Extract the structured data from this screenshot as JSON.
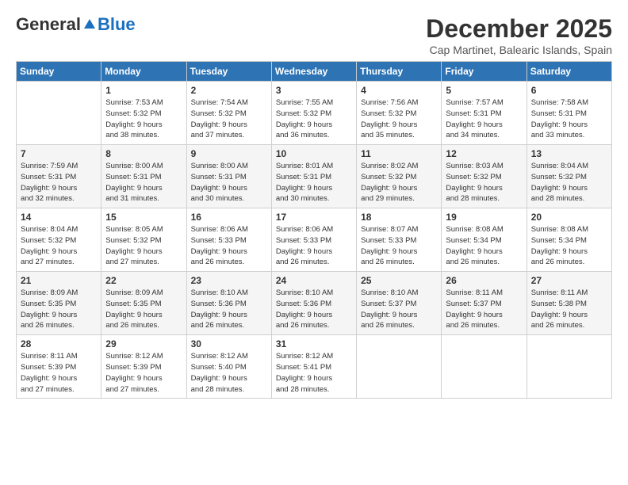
{
  "logo": {
    "general": "General",
    "blue": "Blue"
  },
  "title": "December 2025",
  "subtitle": "Cap Martinet, Balearic Islands, Spain",
  "days_of_week": [
    "Sunday",
    "Monday",
    "Tuesday",
    "Wednesday",
    "Thursday",
    "Friday",
    "Saturday"
  ],
  "weeks": [
    [
      {
        "day": "",
        "info": ""
      },
      {
        "day": "1",
        "info": "Sunrise: 7:53 AM\nSunset: 5:32 PM\nDaylight: 9 hours\nand 38 minutes."
      },
      {
        "day": "2",
        "info": "Sunrise: 7:54 AM\nSunset: 5:32 PM\nDaylight: 9 hours\nand 37 minutes."
      },
      {
        "day": "3",
        "info": "Sunrise: 7:55 AM\nSunset: 5:32 PM\nDaylight: 9 hours\nand 36 minutes."
      },
      {
        "day": "4",
        "info": "Sunrise: 7:56 AM\nSunset: 5:32 PM\nDaylight: 9 hours\nand 35 minutes."
      },
      {
        "day": "5",
        "info": "Sunrise: 7:57 AM\nSunset: 5:31 PM\nDaylight: 9 hours\nand 34 minutes."
      },
      {
        "day": "6",
        "info": "Sunrise: 7:58 AM\nSunset: 5:31 PM\nDaylight: 9 hours\nand 33 minutes."
      }
    ],
    [
      {
        "day": "7",
        "info": "Sunrise: 7:59 AM\nSunset: 5:31 PM\nDaylight: 9 hours\nand 32 minutes."
      },
      {
        "day": "8",
        "info": "Sunrise: 8:00 AM\nSunset: 5:31 PM\nDaylight: 9 hours\nand 31 minutes."
      },
      {
        "day": "9",
        "info": "Sunrise: 8:00 AM\nSunset: 5:31 PM\nDaylight: 9 hours\nand 30 minutes."
      },
      {
        "day": "10",
        "info": "Sunrise: 8:01 AM\nSunset: 5:31 PM\nDaylight: 9 hours\nand 30 minutes."
      },
      {
        "day": "11",
        "info": "Sunrise: 8:02 AM\nSunset: 5:32 PM\nDaylight: 9 hours\nand 29 minutes."
      },
      {
        "day": "12",
        "info": "Sunrise: 8:03 AM\nSunset: 5:32 PM\nDaylight: 9 hours\nand 28 minutes."
      },
      {
        "day": "13",
        "info": "Sunrise: 8:04 AM\nSunset: 5:32 PM\nDaylight: 9 hours\nand 28 minutes."
      }
    ],
    [
      {
        "day": "14",
        "info": "Sunrise: 8:04 AM\nSunset: 5:32 PM\nDaylight: 9 hours\nand 27 minutes."
      },
      {
        "day": "15",
        "info": "Sunrise: 8:05 AM\nSunset: 5:32 PM\nDaylight: 9 hours\nand 27 minutes."
      },
      {
        "day": "16",
        "info": "Sunrise: 8:06 AM\nSunset: 5:33 PM\nDaylight: 9 hours\nand 26 minutes."
      },
      {
        "day": "17",
        "info": "Sunrise: 8:06 AM\nSunset: 5:33 PM\nDaylight: 9 hours\nand 26 minutes."
      },
      {
        "day": "18",
        "info": "Sunrise: 8:07 AM\nSunset: 5:33 PM\nDaylight: 9 hours\nand 26 minutes."
      },
      {
        "day": "19",
        "info": "Sunrise: 8:08 AM\nSunset: 5:34 PM\nDaylight: 9 hours\nand 26 minutes."
      },
      {
        "day": "20",
        "info": "Sunrise: 8:08 AM\nSunset: 5:34 PM\nDaylight: 9 hours\nand 26 minutes."
      }
    ],
    [
      {
        "day": "21",
        "info": "Sunrise: 8:09 AM\nSunset: 5:35 PM\nDaylight: 9 hours\nand 26 minutes."
      },
      {
        "day": "22",
        "info": "Sunrise: 8:09 AM\nSunset: 5:35 PM\nDaylight: 9 hours\nand 26 minutes."
      },
      {
        "day": "23",
        "info": "Sunrise: 8:10 AM\nSunset: 5:36 PM\nDaylight: 9 hours\nand 26 minutes."
      },
      {
        "day": "24",
        "info": "Sunrise: 8:10 AM\nSunset: 5:36 PM\nDaylight: 9 hours\nand 26 minutes."
      },
      {
        "day": "25",
        "info": "Sunrise: 8:10 AM\nSunset: 5:37 PM\nDaylight: 9 hours\nand 26 minutes."
      },
      {
        "day": "26",
        "info": "Sunrise: 8:11 AM\nSunset: 5:37 PM\nDaylight: 9 hours\nand 26 minutes."
      },
      {
        "day": "27",
        "info": "Sunrise: 8:11 AM\nSunset: 5:38 PM\nDaylight: 9 hours\nand 26 minutes."
      }
    ],
    [
      {
        "day": "28",
        "info": "Sunrise: 8:11 AM\nSunset: 5:39 PM\nDaylight: 9 hours\nand 27 minutes."
      },
      {
        "day": "29",
        "info": "Sunrise: 8:12 AM\nSunset: 5:39 PM\nDaylight: 9 hours\nand 27 minutes."
      },
      {
        "day": "30",
        "info": "Sunrise: 8:12 AM\nSunset: 5:40 PM\nDaylight: 9 hours\nand 28 minutes."
      },
      {
        "day": "31",
        "info": "Sunrise: 8:12 AM\nSunset: 5:41 PM\nDaylight: 9 hours\nand 28 minutes."
      },
      {
        "day": "",
        "info": ""
      },
      {
        "day": "",
        "info": ""
      },
      {
        "day": "",
        "info": ""
      }
    ]
  ]
}
